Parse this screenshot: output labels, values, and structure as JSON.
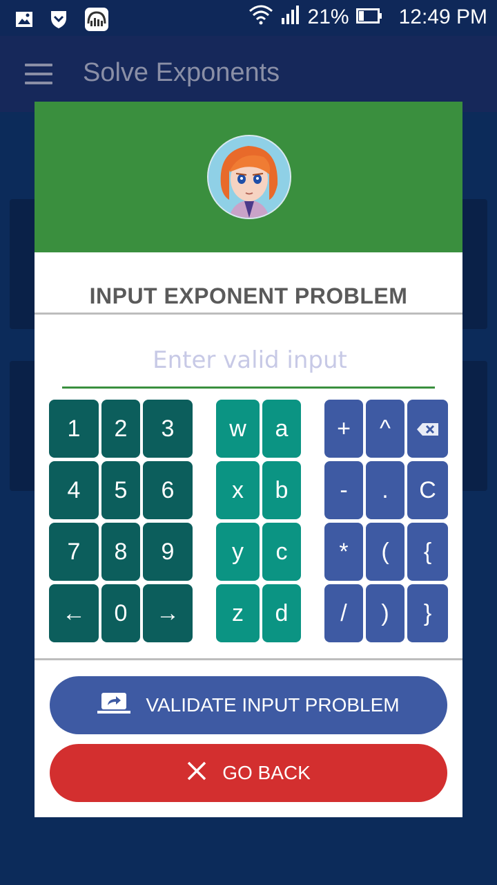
{
  "status": {
    "battery": "21%",
    "time": "12:49 PM"
  },
  "app_bar": {
    "title": "Solve Exponents"
  },
  "dialog": {
    "title": "INPUT EXPONENT PROBLEM",
    "input": {
      "placeholder": "Enter valid input",
      "value": ""
    },
    "keypad": {
      "numbers": [
        [
          "1",
          "2",
          "3"
        ],
        [
          "4",
          "5",
          "6"
        ],
        [
          "7",
          "8",
          "9"
        ],
        [
          "←",
          "0",
          "→"
        ]
      ],
      "letters": [
        [
          "w",
          "a"
        ],
        [
          "x",
          "b"
        ],
        [
          "y",
          "c"
        ],
        [
          "z",
          "d"
        ]
      ],
      "operators": [
        [
          "+",
          "^",
          "⌫"
        ],
        [
          "-",
          ".",
          "C"
        ],
        [
          "*",
          "(",
          "{"
        ],
        [
          "/",
          ")",
          "}"
        ]
      ]
    },
    "validate_label": "VALIDATE INPUT PROBLEM",
    "back_label": "GO BACK"
  },
  "colors": {
    "header_green": "#3a8f3e",
    "key_number": "#0c5e5c",
    "key_letter": "#0b9483",
    "key_operator": "#3e5aa3",
    "validate": "#3e5aa3",
    "back": "#d32f2f"
  }
}
